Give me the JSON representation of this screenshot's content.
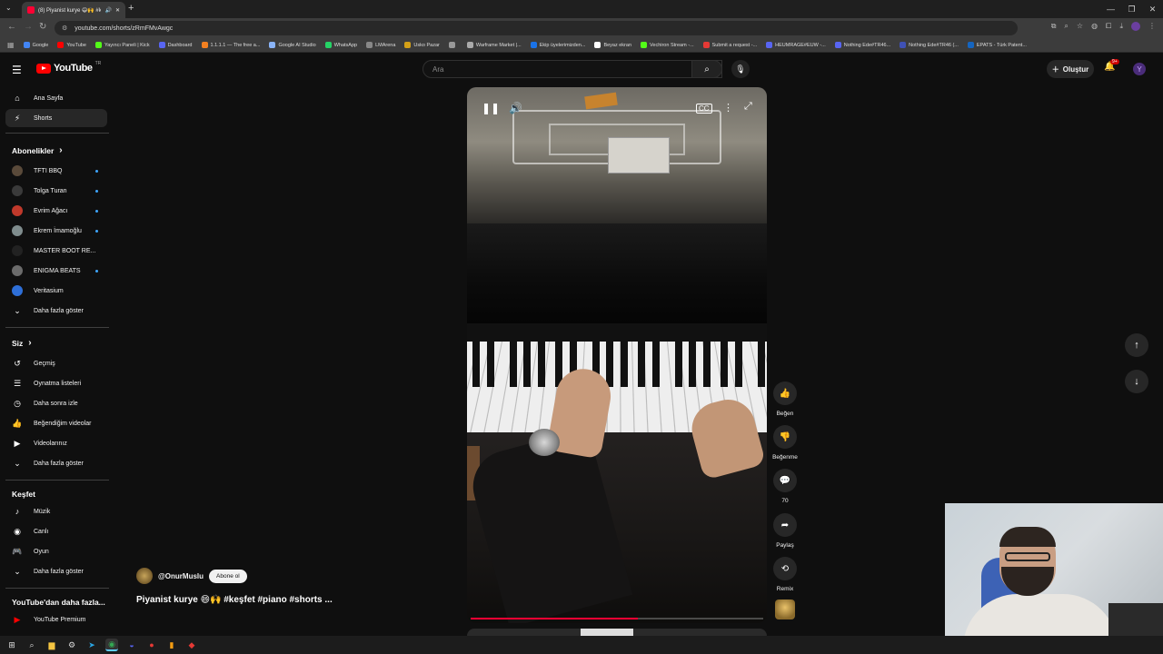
{
  "browser": {
    "tab_title": "(8) Piyanist kurye 😄🙌 #k...",
    "url": "youtube.com/shorts/zRmFMvAwgc",
    "bookmarks": [
      {
        "label": "Google",
        "color": "#4285f4"
      },
      {
        "label": "YouTube",
        "color": "#ff0000"
      },
      {
        "label": "Yayıncı Paneli | Kick",
        "color": "#53fc18"
      },
      {
        "label": "Dashboard",
        "color": "#5865f2"
      },
      {
        "label": "1.1.1.1 — The free a...",
        "color": "#f38020"
      },
      {
        "label": "Google AI Studio",
        "color": "#8ab4f8"
      },
      {
        "label": "WhatsApp",
        "color": "#25d366"
      },
      {
        "label": "LMArena",
        "color": "#888888"
      },
      {
        "label": "Usko Pazar",
        "color": "#d4a017"
      },
      {
        "label": "",
        "color": "#999999"
      },
      {
        "label": "Warframe Market |...",
        "color": "#aaaaaa"
      },
      {
        "label": "Ekip üyelerimizden...",
        "color": "#1a73e8"
      },
      {
        "label": "Beyaz ekran",
        "color": "#ffffff"
      },
      {
        "label": "Vechiron Stream -...",
        "color": "#53fc18"
      },
      {
        "label": "Submit a request -...",
        "color": "#e53935"
      },
      {
        "label": "HEUMRAGE#EUW -...",
        "color": "#5865f2"
      },
      {
        "label": "Nothing Ede#TR46...",
        "color": "#5865f2"
      },
      {
        "label": "Nothing Ede#TR46 (...",
        "color": "#3f51b5"
      },
      {
        "label": "EPATS - Türk Patent...",
        "color": "#1565c0"
      }
    ]
  },
  "header": {
    "logo_text": "YouTube",
    "logo_country": "TR",
    "search_placeholder": "Ara",
    "create_label": "Oluştur",
    "notifications_count": "9+",
    "avatar_letter": "Y"
  },
  "sidebar": {
    "main": [
      {
        "label": "Ana Sayfa",
        "icon": "home-icon",
        "glyph": "⌂"
      },
      {
        "label": "Shorts",
        "icon": "shorts-icon",
        "glyph": "⚡"
      }
    ],
    "subscriptions_heading": "Abonelikler",
    "subscriptions": [
      {
        "label": "TFTI BBQ",
        "color": "#5a4a3a",
        "new": true
      },
      {
        "label": "Tolga Turan",
        "color": "#3a3a3a",
        "new": true
      },
      {
        "label": "Evrim Ağacı",
        "color": "#c0392b",
        "new": true
      },
      {
        "label": "Ekrem İmamoğlu",
        "color": "#7f8c8d",
        "new": true
      },
      {
        "label": "MASTER BOOT RE...",
        "color": "#222222",
        "new": false
      },
      {
        "label": "ENIGMA BEATS",
        "color": "#6b6b6b",
        "new": true
      },
      {
        "label": "Veritasium",
        "color": "#2e6fd8",
        "new": false
      }
    ],
    "show_more_1": "Daha fazla göster",
    "you_heading": "Siz",
    "you_items": [
      {
        "label": "Geçmiş",
        "icon": "history-icon",
        "glyph": "↺"
      },
      {
        "label": "Oynatma listeleri",
        "icon": "playlists-icon",
        "glyph": "☰"
      },
      {
        "label": "Daha sonra izle",
        "icon": "watch-later-icon",
        "glyph": "◷"
      },
      {
        "label": "Beğendiğim videolar",
        "icon": "liked-videos-icon",
        "glyph": "👍"
      },
      {
        "label": "Videolarınız",
        "icon": "your-videos-icon",
        "glyph": "▶"
      }
    ],
    "show_more_2": "Daha fazla göster",
    "explore_heading": "Keşfet",
    "explore_items": [
      {
        "label": "Müzik",
        "icon": "music-icon",
        "glyph": "♪"
      },
      {
        "label": "Canlı",
        "icon": "live-icon",
        "glyph": "◉"
      },
      {
        "label": "Oyun",
        "icon": "gaming-icon",
        "glyph": "🎮"
      }
    ],
    "show_more_3": "Daha fazla göster",
    "more_heading": "YouTube'dan daha fazla...",
    "more_items": [
      {
        "label": "YouTube Premium",
        "icon": "premium-icon",
        "color": "#ff0000"
      }
    ]
  },
  "short": {
    "channel": "@OnurMuslu",
    "subscribe_label": "Abone ol",
    "title": "Piyanist kurye 😄🙌 #keşfet #piano #shorts ...",
    "progress": 0.57
  },
  "actions": {
    "like_label": "Beğen",
    "dislike_label": "Beğenme",
    "comments_count": "70",
    "share_label": "Paylaş",
    "remix_label": "Remix"
  }
}
